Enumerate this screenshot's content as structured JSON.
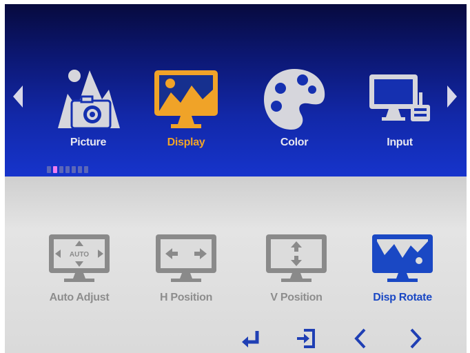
{
  "main_menu": {
    "items": [
      {
        "label": "Picture",
        "icon": "picture-icon"
      },
      {
        "label": "Display",
        "icon": "display-icon",
        "selected": true
      },
      {
        "label": "Color",
        "icon": "palette-icon"
      },
      {
        "label": "Input",
        "icon": "input-icon"
      }
    ],
    "page_dots": 7,
    "active_dot": 1
  },
  "sub_menu": {
    "items": [
      {
        "label": "Auto Adjust",
        "icon": "auto-adjust-icon",
        "icon_text": "AUTO"
      },
      {
        "label": "H Position",
        "icon": "h-position-icon"
      },
      {
        "label": "V Position",
        "icon": "v-position-icon"
      },
      {
        "label": "Disp Rotate",
        "icon": "disp-rotate-icon",
        "selected": true
      }
    ]
  },
  "nav_keys": [
    "enter-icon",
    "exit-icon",
    "left-icon",
    "right-icon"
  ],
  "colors": {
    "selected_top": "#f0a328",
    "selected_bottom": "#1a48c4",
    "inactive_icon_top": "#d6d6dc",
    "inactive_icon_bottom": "#8a8a8a",
    "nav_key": "#1f3fb4"
  }
}
